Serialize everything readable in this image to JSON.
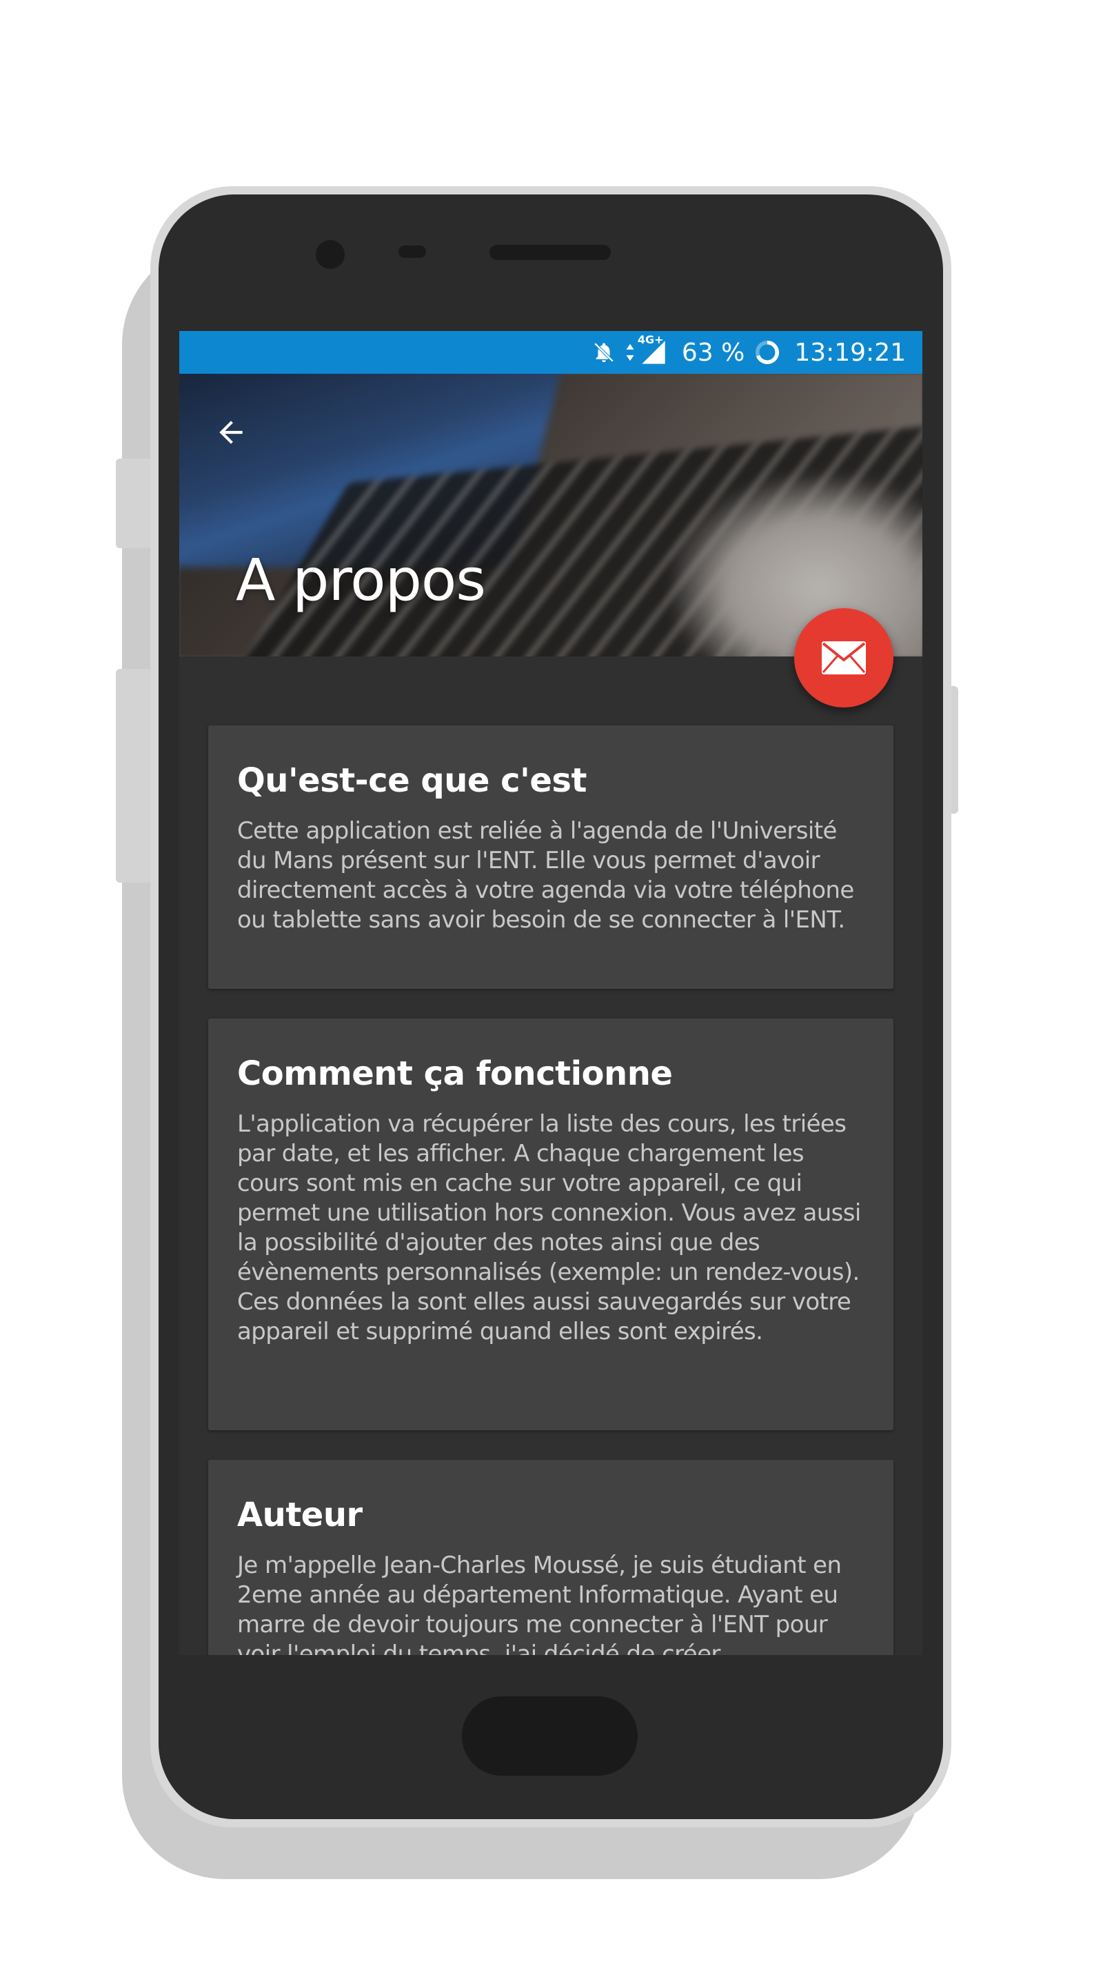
{
  "status_bar": {
    "network": "4G+",
    "battery": "63 %",
    "time": "13:19:21",
    "icons": [
      "notifications-off-icon",
      "data-arrows-icon",
      "signal-icon",
      "battery-ring-icon"
    ]
  },
  "toolbar": {
    "title": "A propos",
    "back_icon": "arrow-left-icon",
    "fab_icon": "mail-icon"
  },
  "cards": [
    {
      "title": "Qu'est-ce que c'est",
      "body": "Cette application est reliée à l'agenda de l'Université du Mans présent sur l'ENT. Elle vous permet d'avoir directement accès à votre agenda via votre téléphone ou tablette sans avoir besoin de se connecter à l'ENT."
    },
    {
      "title": "Comment ça fonctionne",
      "body": "L'application va récupérer la liste des cours, les triées par date, et les afficher. A chaque chargement les cours sont mis en cache sur votre appareil, ce qui permet une utilisation hors connexion. Vous avez aussi la possibilité d'ajouter des notes ainsi que des évènements personnalisés (exemple: un rendez-vous). Ces données la sont elles aussi sauvegardés sur votre appareil et supprimé quand elles sont expirés."
    },
    {
      "title": "Auteur",
      "body": "Je m'appelle Jean-Charles Moussé, je suis étudiant en 2eme année au département Informatique. Ayant eu marre de devoir toujours me connecter à l'ENT pour voir l'emploi du temps, j'ai décidé de créer"
    }
  ],
  "colors": {
    "status_bar": "#0d88d0",
    "fab": "#e53a30",
    "screen_bg": "#303030",
    "card_bg": "#424242"
  }
}
